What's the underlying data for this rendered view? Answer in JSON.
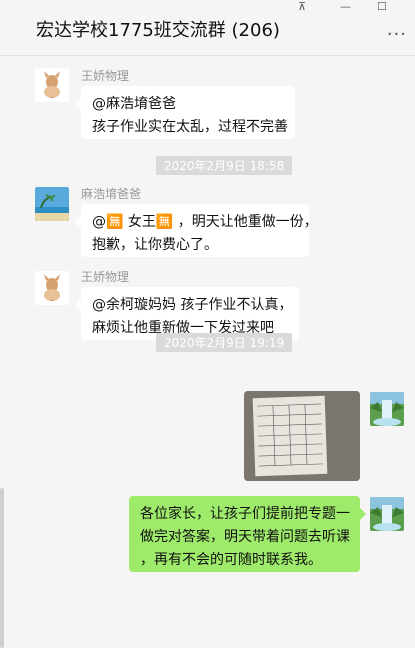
{
  "window": {
    "pin_icon": "pin-icon",
    "minimize_icon": "minimize-icon",
    "maximize_icon": "maximize-icon"
  },
  "header": {
    "title": "宏达学校1775班交流群 (206)",
    "more_label": "···"
  },
  "messages": [
    {
      "sender": "王娇物理",
      "lines": [
        "@麻浩堉爸爸",
        "孩子作业实在太乱，过程不完善"
      ]
    },
    {
      "time": "2020年2月9日  18:58"
    },
    {
      "sender": "麻浩堉爸爸",
      "lines": [
        "@🈚 女王🈚 ，明天让他重做一份，",
        "抱歉，让你费心了。"
      ]
    },
    {
      "sender": "王娇物理",
      "lines": [
        "@余柯璇妈妈 孩子作业不认真，",
        "麻烦让他重新做一下发过来吧"
      ]
    },
    {
      "time": "2020年2月9日  19:19"
    },
    {
      "type": "image",
      "content": "worksheet-photo"
    },
    {
      "lines": [
        "各位家长，让孩子们提前把专题一",
        "做完对答案，明天带着问题去听课",
        "，再有不会的可随时联系我。"
      ]
    }
  ]
}
